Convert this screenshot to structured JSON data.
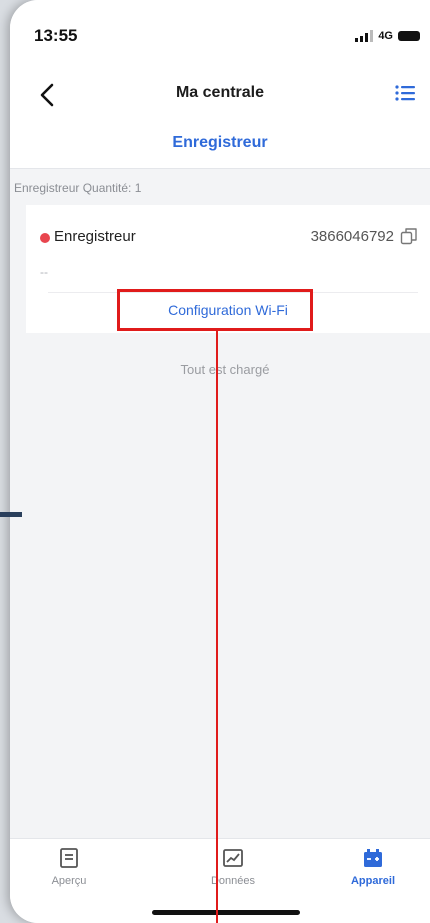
{
  "status_bar": {
    "time": "13:55",
    "network": "4G"
  },
  "header": {
    "title": "Ma centrale",
    "back_icon": "chevron-left-icon",
    "menu_icon": "list-menu-icon"
  },
  "tabs": [
    {
      "label": "Enregistreur",
      "active": true
    }
  ],
  "device_list": {
    "quantity_label": "Enregistreur Quantité: 1",
    "devices": [
      {
        "name": "Enregistreur",
        "serial": "3866046792",
        "subtitle": "--",
        "status": "offline",
        "status_color": "#e8454e",
        "action_label": "Configuration Wi-Fi"
      }
    ],
    "footer_text": "Tout est chargé"
  },
  "bottom_nav": [
    {
      "label": "Aperçu",
      "icon": "document-icon",
      "active": false
    },
    {
      "label": "Données",
      "icon": "chart-icon",
      "active": false
    },
    {
      "label": "Appareil",
      "icon": "device-icon",
      "active": true
    }
  ],
  "colors": {
    "accent": "#2f6ad9",
    "highlight": "#e01b1b",
    "status_offline": "#e8454e"
  }
}
